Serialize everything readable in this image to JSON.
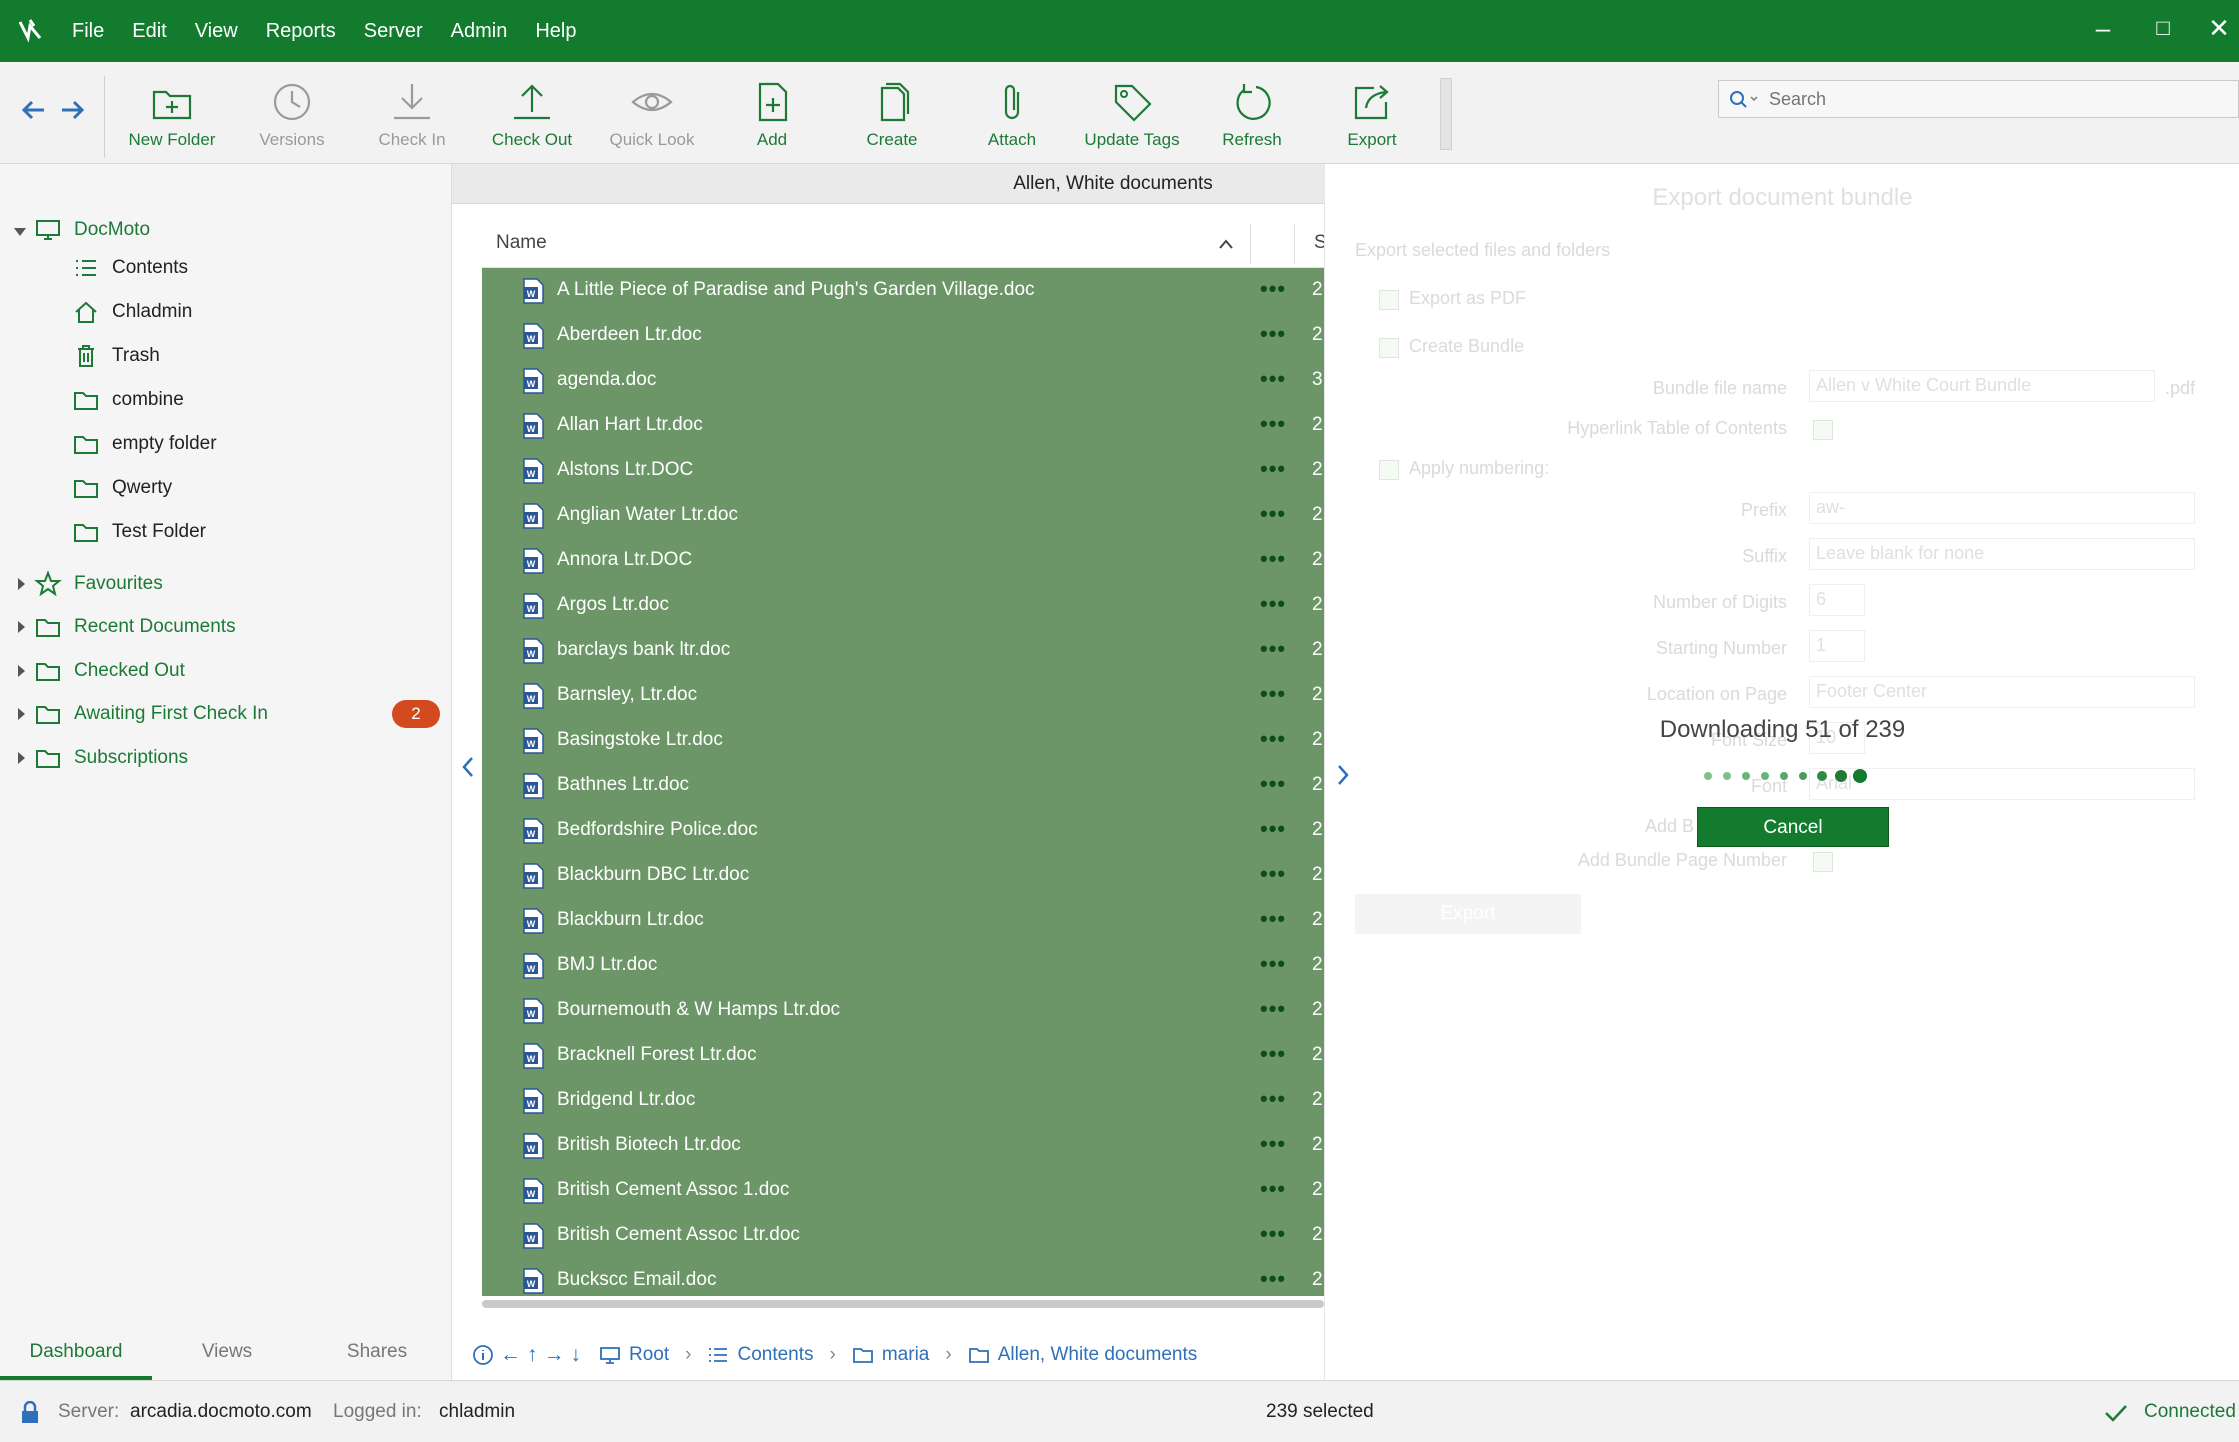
{
  "menu": [
    "File",
    "Edit",
    "View",
    "Reports",
    "Server",
    "Admin",
    "Help"
  ],
  "toolbar": {
    "buttons": [
      {
        "label": "New Folder",
        "icon": "new-folder-icon",
        "enabled": true
      },
      {
        "label": "Versions",
        "icon": "clock-icon",
        "enabled": false
      },
      {
        "label": "Check In",
        "icon": "download-icon",
        "enabled": false
      },
      {
        "label": "Check Out",
        "icon": "upload-icon",
        "enabled": true
      },
      {
        "label": "Quick Look",
        "icon": "eye-icon",
        "enabled": false
      },
      {
        "label": "Add",
        "icon": "add-file-icon",
        "enabled": true
      },
      {
        "label": "Create",
        "icon": "document-icon",
        "enabled": true
      },
      {
        "label": "Attach",
        "icon": "paperclip-icon",
        "enabled": true
      },
      {
        "label": "Update Tags",
        "icon": "tag-icon",
        "enabled": true
      },
      {
        "label": "Refresh",
        "icon": "refresh-icon",
        "enabled": true
      },
      {
        "label": "Export",
        "icon": "export-icon",
        "enabled": true
      }
    ],
    "search_placeholder": "Search"
  },
  "sidebar": {
    "root": "DocMoto",
    "children": [
      "Contents",
      "Chladmin",
      "Trash",
      "combine",
      "empty folder",
      "Qwerty",
      "Test Folder"
    ],
    "groups": [
      "Favourites",
      "Recent Documents",
      "Checked Out",
      "Awaiting First Check In",
      "Subscriptions"
    ],
    "awaiting_badge": "2",
    "tabs": [
      "Dashboard",
      "Views",
      "Shares"
    ],
    "active_tab": "Dashboard"
  },
  "list": {
    "title": "Allen, White documents",
    "column_name": "Name",
    "column_2_initial": "S",
    "files": [
      {
        "name": "A Little Piece of Paradise and Pugh's Garden Village.doc",
        "c2": "2"
      },
      {
        "name": "Aberdeen Ltr.doc",
        "c2": "2"
      },
      {
        "name": "agenda.doc",
        "c2": "3"
      },
      {
        "name": "Allan Hart Ltr.doc",
        "c2": "2"
      },
      {
        "name": "Alstons Ltr.DOC",
        "c2": "2"
      },
      {
        "name": "Anglian Water Ltr.doc",
        "c2": "2"
      },
      {
        "name": "Annora Ltr.DOC",
        "c2": "2"
      },
      {
        "name": "Argos Ltr.doc",
        "c2": "2"
      },
      {
        "name": "barclays bank ltr.doc",
        "c2": "2"
      },
      {
        "name": "Barnsley, Ltr.doc",
        "c2": "2"
      },
      {
        "name": "Basingstoke Ltr.doc",
        "c2": "2"
      },
      {
        "name": "Bathnes Ltr.doc",
        "c2": "2"
      },
      {
        "name": "Bedfordshire Police.doc",
        "c2": "2"
      },
      {
        "name": "Blackburn DBC Ltr.doc",
        "c2": "2"
      },
      {
        "name": "Blackburn Ltr.doc",
        "c2": "2"
      },
      {
        "name": "BMJ Ltr.doc",
        "c2": "2"
      },
      {
        "name": "Bournemouth & W Hamps Ltr.doc",
        "c2": "2"
      },
      {
        "name": "Bracknell Forest Ltr.doc",
        "c2": "2"
      },
      {
        "name": "Bridgend Ltr.doc",
        "c2": "2"
      },
      {
        "name": "British Biotech Ltr.doc",
        "c2": "2"
      },
      {
        "name": "British Cement Assoc 1.doc",
        "c2": "2"
      },
      {
        "name": "British Cement Assoc Ltr.doc",
        "c2": "2"
      },
      {
        "name": "Buckscc Email.doc",
        "c2": "2"
      }
    ]
  },
  "pathbar": [
    "Root",
    "Contents",
    "maria",
    "Allen, White documents"
  ],
  "export_panel": {
    "title": "Export document bundle",
    "subtitle": "Export selected files and folders",
    "export_as_pdf": "Export as PDF",
    "create_bundle": "Create Bundle",
    "bundle_file_name_label": "Bundle file name",
    "bundle_file_name": "Allen v White Court Bundle",
    "bundle_ext": ".pdf",
    "hyperlink_toc": "Hyperlink Table of Contents",
    "apply_numbering": "Apply numbering:",
    "prefix_label": "Prefix",
    "prefix": "aw-",
    "suffix_label": "Suffix",
    "suffix_placeholder": "Leave blank for none",
    "digits_label": "Number of Digits",
    "digits": "6",
    "starting_label": "Starting Number",
    "starting": "1",
    "location_label": "Location on Page",
    "location": "Footer Center",
    "font_size_label": "Font Size",
    "font_size": "10",
    "font_label": "Font",
    "font": "Arial",
    "add_b_label": "Add B",
    "add_page_label": "Add Bundle Page Number",
    "export_button": "Export",
    "progress_text": "Downloading 51 of 239",
    "cancel_button": "Cancel"
  },
  "status": {
    "server_label": "Server:",
    "server": "arcadia.docmoto.com",
    "logged_label": "Logged in:",
    "user": "chladmin",
    "selected": "239 selected",
    "connection": "Connected"
  },
  "colors": {
    "brand_green": "#137b2e",
    "selection": "#6c9668",
    "link_blue": "#2f70b8",
    "badge": "#d34a1e"
  }
}
